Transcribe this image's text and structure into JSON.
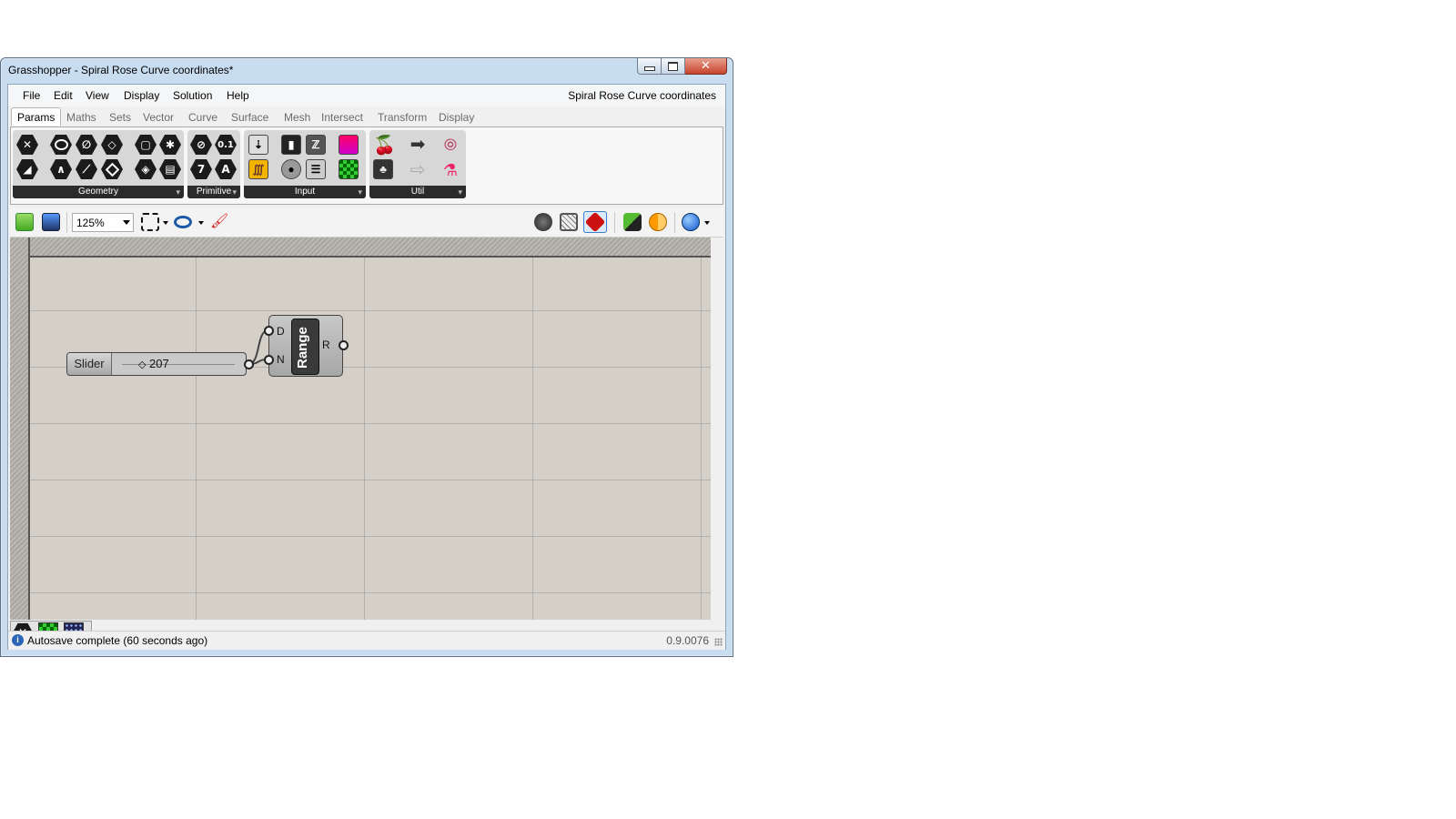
{
  "window": {
    "title": "Grasshopper - Spiral Rose Curve coordinates*"
  },
  "menu": {
    "items": [
      "File",
      "Edit",
      "View",
      "Display",
      "Solution",
      "Help"
    ],
    "document": "Spiral Rose Curve coordinates"
  },
  "tabs": [
    "Params",
    "Maths",
    "Sets",
    "Vector",
    "Curve",
    "Surface",
    "Mesh",
    "Intersect",
    "Transform",
    "Display"
  ],
  "ribbon": {
    "groups": [
      "Geometry",
      "Primitive",
      "Input",
      "Util"
    ],
    "primitive_glyphs": [
      "0.1",
      "7",
      "A"
    ]
  },
  "toolbar": {
    "zoom": "125%"
  },
  "canvas": {
    "slider": {
      "name": "Slider",
      "knob": "◇",
      "value": "207"
    },
    "range": {
      "title": "Range",
      "inputs": [
        "D",
        "N"
      ],
      "output": "R"
    }
  },
  "status": {
    "icon": "i",
    "message": "Autosave complete (60 seconds ago)",
    "version": "0.9.0076"
  },
  "colors": {
    "title_bar": "#c9ddf0",
    "canvas": "#d4d0c8",
    "close_button": "#c8442c"
  }
}
